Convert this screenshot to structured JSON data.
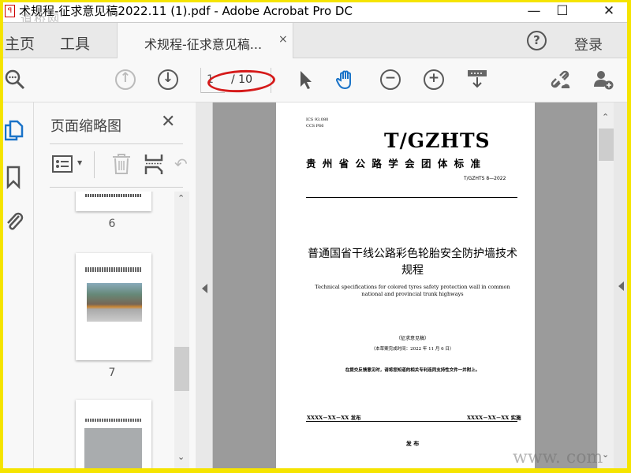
{
  "window": {
    "title": "术规程-征求意见稿2022.11 (1).pdf - Adobe Acrobat Pro DC",
    "minimize": "—",
    "maximize": "☐",
    "close": "✕"
  },
  "watermark": {
    "top": "道桥网",
    "bottom": "www.        com"
  },
  "nav": {
    "home": "主页",
    "tools": "工具",
    "tab_label": "术规程-征求意见稿...",
    "tab_close": "×",
    "help": "?",
    "login": "登录"
  },
  "toolbar": {
    "current_page": "1",
    "total_pages": "/ 10"
  },
  "sidebar": {
    "title": "页面缩略图",
    "close": "✕",
    "thumbnails": [
      {
        "label": "6"
      },
      {
        "label": "7"
      }
    ]
  },
  "document": {
    "ics": "ICS  93.080",
    "ccs": "CCS P66",
    "logo": "T/GZHTS",
    "org": "贵 州 省 公 路 学 会 团 体 标 准",
    "code": "T/GZHTS 8—2022",
    "title_cn": "普通国省干线公路彩色轮胎安全防护墙技术规程",
    "title_en": "Technical specifications for colored tyres safety protection wall in common national and provincial trunk highways",
    "draft": "（征求意见稿）",
    "draft_date": "（本草案完成时间：2022 年 11 月 6 日）",
    "notice": "在提交反馈意见时，请将您知道的相关专利连同支持性文件一并附上。",
    "issue": "XXXX－XX－XX 发布",
    "implement": "XXXX－XX－XX 实施",
    "publish": "发 布"
  }
}
